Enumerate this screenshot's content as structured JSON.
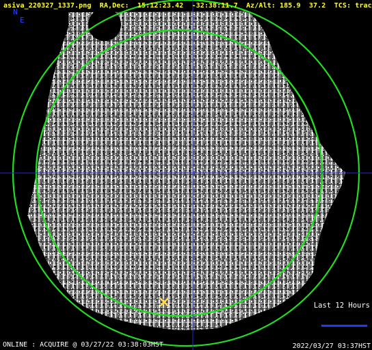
{
  "header": {
    "filename": "asiva_220327_1337.png",
    "radec_label": "RA,Dec:",
    "ra": "15:12:23.42",
    "dec": "-32:38:11.7",
    "azalt_label": "Az/Alt:",
    "az": "185.9",
    "alt": "37.2",
    "tcs_label": "TCS:",
    "tcs_state": "track"
  },
  "compass": {
    "north": "N",
    "east": "E"
  },
  "legend": {
    "label": "Last 12 Hours"
  },
  "status": {
    "left": "ONLINE : ACQUIRE @ 03/27/22 03:38:03HST",
    "right": "2022/03/27 03:37HST"
  },
  "colors": {
    "header_text": "#ffff33",
    "circle": "#22dd22",
    "crosshair": "#1f2bd6",
    "target_marker": "#ffd84a",
    "compass": "#2a44ff"
  },
  "icons": {
    "target": "x-marker-icon"
  }
}
